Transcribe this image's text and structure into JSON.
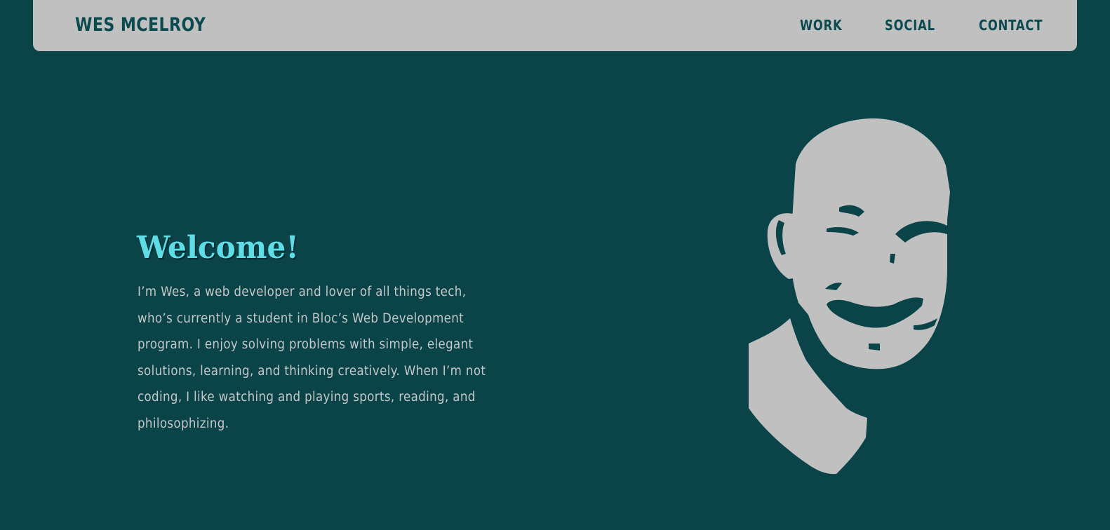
{
  "header": {
    "brand": "WES MCELROY",
    "nav": [
      {
        "label": "WORK"
      },
      {
        "label": "SOCIAL"
      },
      {
        "label": "CONTACT"
      }
    ]
  },
  "hero": {
    "title": "Welcome!",
    "intro_lines": [
      "I’m Wes, a web developer and lover of all things tech,",
      "who’s currently a student in Bloc’s Web Development",
      "program. I enjoy solving problems with simple, elegant",
      "solutions, learning, and thinking creatively. When I’m not",
      "coding, I like watching and playing sports, reading, and",
      "philosophizing."
    ]
  },
  "colors": {
    "background": "#0a4449",
    "navbar": "#c0c0c0",
    "accent": "#5fdde6",
    "text": "#c4c8c8"
  }
}
